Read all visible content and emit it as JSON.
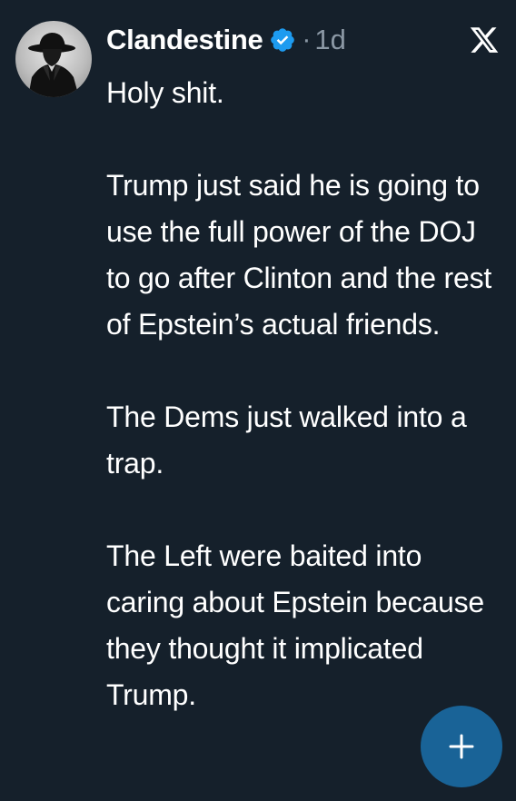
{
  "author": {
    "name": "Clandestine",
    "verified": true,
    "separator": "·",
    "timestamp": "1d",
    "avatar_icon": "spy-fedora-silhouette-icon"
  },
  "platform": {
    "logo_icon": "x-logo-icon"
  },
  "tweet": {
    "paragraphs": [
      "Holy shit.",
      "Trump just said he is going to use the full power of the DOJ to go after Clinton and the rest of Epstein’s actual friends.",
      "The Dems just walked into a trap.",
      "The Left were baited into caring about Epstein because they thought it implicated Trump."
    ]
  },
  "compose_button": {
    "icon": "plus-icon"
  },
  "colors": {
    "background": "#15202b",
    "text_primary": "#ffffff",
    "text_secondary": "#8b98a5",
    "accent": "#1d9bf0"
  }
}
